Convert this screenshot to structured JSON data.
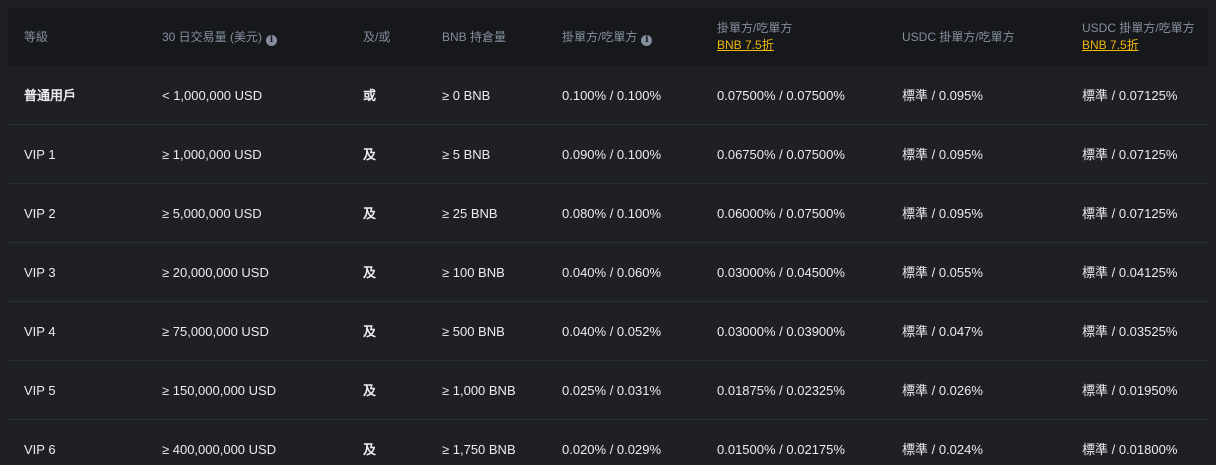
{
  "header": {
    "level": "等級",
    "volume": "30 日交易量 (美元)",
    "andor": "及/或",
    "bnb": "BNB 持倉量",
    "maker_taker": "掛單方/吃單方",
    "maker_taker_bnb": "掛單方/吃單方",
    "bnb_discount": "BNB 7.5折",
    "usdc": "USDC 掛單方/吃單方",
    "usdc_bnb": "USDC 掛單方/吃單方",
    "usdc_bnb_discount": "BNB 7.5折"
  },
  "rows": [
    {
      "level": "普通用戶",
      "volume": "< 1,000,000 USD",
      "andor": "或",
      "bnb": "≥ 0 BNB",
      "fee": "0.100% / 0.100%",
      "fee_bnb": "0.07500% / 0.07500%",
      "usdc": "標準 / 0.095%",
      "usdc_bnb": "標準 / 0.07125%"
    },
    {
      "level": "VIP 1",
      "volume": "≥ 1,000,000 USD",
      "andor": "及",
      "bnb": "≥ 5 BNB",
      "fee": "0.090% / 0.100%",
      "fee_bnb": "0.06750% / 0.07500%",
      "usdc": "標準 / 0.095%",
      "usdc_bnb": "標準 / 0.07125%"
    },
    {
      "level": "VIP 2",
      "volume": "≥ 5,000,000 USD",
      "andor": "及",
      "bnb": "≥ 25 BNB",
      "fee": "0.080% / 0.100%",
      "fee_bnb": "0.06000% / 0.07500%",
      "usdc": "標準 / 0.095%",
      "usdc_bnb": "標準 / 0.07125%"
    },
    {
      "level": "VIP 3",
      "volume": "≥ 20,000,000 USD",
      "andor": "及",
      "bnb": "≥ 100 BNB",
      "fee": "0.040% / 0.060%",
      "fee_bnb": "0.03000% / 0.04500%",
      "usdc": "標準 / 0.055%",
      "usdc_bnb": "標準 / 0.04125%"
    },
    {
      "level": "VIP 4",
      "volume": "≥ 75,000,000 USD",
      "andor": "及",
      "bnb": "≥ 500 BNB",
      "fee": "0.040% / 0.052%",
      "fee_bnb": "0.03000% / 0.03900%",
      "usdc": "標準 / 0.047%",
      "usdc_bnb": "標準 / 0.03525%"
    },
    {
      "level": "VIP 5",
      "volume": "≥ 150,000,000 USD",
      "andor": "及",
      "bnb": "≥ 1,000 BNB",
      "fee": "0.025% / 0.031%",
      "fee_bnb": "0.01875% / 0.02325%",
      "usdc": "標準 / 0.026%",
      "usdc_bnb": "標準 / 0.01950%"
    },
    {
      "level": "VIP 6",
      "volume": "≥ 400,000,000 USD",
      "andor": "及",
      "bnb": "≥ 1,750 BNB",
      "fee": "0.020% / 0.029%",
      "fee_bnb": "0.01500% / 0.02175%",
      "usdc": "標準 / 0.024%",
      "usdc_bnb": "標準 / 0.01800%"
    }
  ],
  "icons": {
    "info": "info-icon"
  },
  "colors": {
    "accent": "#f0b90b",
    "header_bg": "#16181c",
    "row_bg": "#1e2026",
    "muted": "#848e9c"
  }
}
